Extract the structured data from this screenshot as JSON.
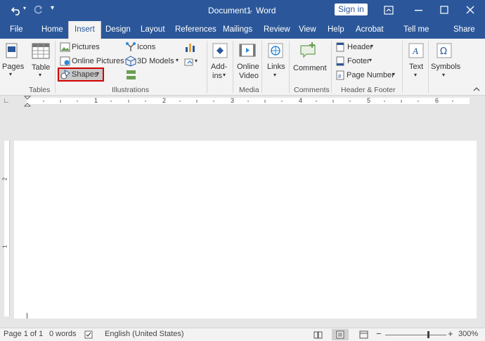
{
  "title_bar": {
    "title": "Document1",
    "separator": "-",
    "app_name": "Word",
    "sign_in": "Sign in"
  },
  "tabs": [
    "File",
    "Home",
    "Insert",
    "Design",
    "Layout",
    "References",
    "Mailings",
    "Review",
    "View",
    "Help",
    "Acrobat",
    "Tell me",
    "Share"
  ],
  "ribbon": {
    "pages": "Pages",
    "table": "Table",
    "tables_group": "Tables",
    "pictures": "Pictures",
    "online_pictures": "Online Pictures",
    "shapes": "Shapes",
    "icons": "Icons",
    "models_3d": "3D Models",
    "illustrations_group": "Illustrations",
    "addins_1": "Add-",
    "addins_2": "ins",
    "online_video_1": "Online",
    "online_video_2": "Video",
    "media_group": "Media",
    "links": "Links",
    "comment": "Comment",
    "comments_group": "Comments",
    "header": "Header",
    "footer": "Footer",
    "page_number": "Page Number",
    "header_footer_group": "Header & Footer",
    "text": "Text",
    "symbols": "Symbols"
  },
  "ruler": {
    "marks": [
      "1",
      "2",
      "3",
      "4",
      "5",
      "6"
    ],
    "vertical_marks": [
      "2",
      "1"
    ]
  },
  "status": {
    "page": "Page 1 of 1",
    "words": "0 words",
    "language": "English (United States)",
    "zoom_minus": "−",
    "zoom_plus": "+",
    "zoom": "300%"
  },
  "colors": {
    "brand": "#2b579a",
    "highlight": "#d20000"
  }
}
